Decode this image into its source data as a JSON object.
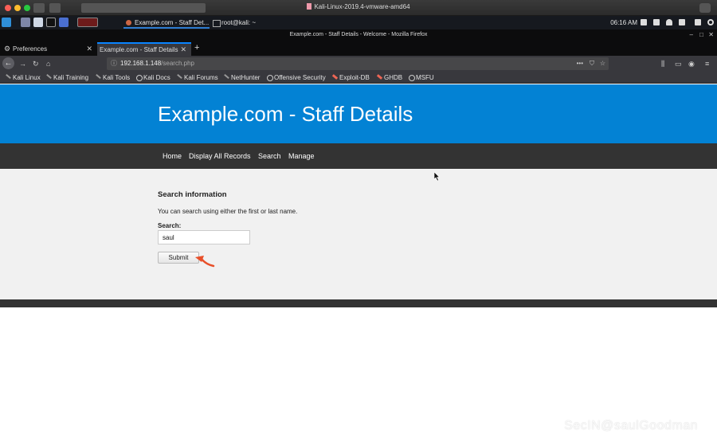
{
  "vm_window": {
    "title": "Kali-Linux-2019.4-vmware-amd64"
  },
  "panel": {
    "tasks": [
      {
        "label": "Example.com - Staff Det..."
      },
      {
        "label": "root@kali: ~"
      }
    ],
    "clock": "06:16 AM"
  },
  "firefox": {
    "window_title": "Example.com - Staff Details - Welcome - Mozilla Firefox",
    "tabs": [
      {
        "label": "Preferences"
      },
      {
        "label": "Example.com - Staff Details"
      }
    ],
    "url_host": "192.168.1.148",
    "url_path": "/search.php",
    "bookmarks": [
      "Kali Linux",
      "Kali Training",
      "Kali Tools",
      "Kali Docs",
      "Kali Forums",
      "NetHunter",
      "Offensive Security",
      "Exploit-DB",
      "GHDB",
      "MSFU"
    ]
  },
  "page": {
    "site_title": "Example.com - Staff Details",
    "menu": [
      "Home",
      "Display All Records",
      "Search",
      "Manage"
    ],
    "heading": "Search information",
    "description": "You can search using either the first or last name.",
    "search_label": "Search:",
    "search_value": "saul",
    "submit_label": "Submit"
  },
  "watermark": "SecIN@saulGoodman",
  "colors": {
    "hero": "#0382d4",
    "menubar": "#333333",
    "arrow": "#e8502a"
  }
}
